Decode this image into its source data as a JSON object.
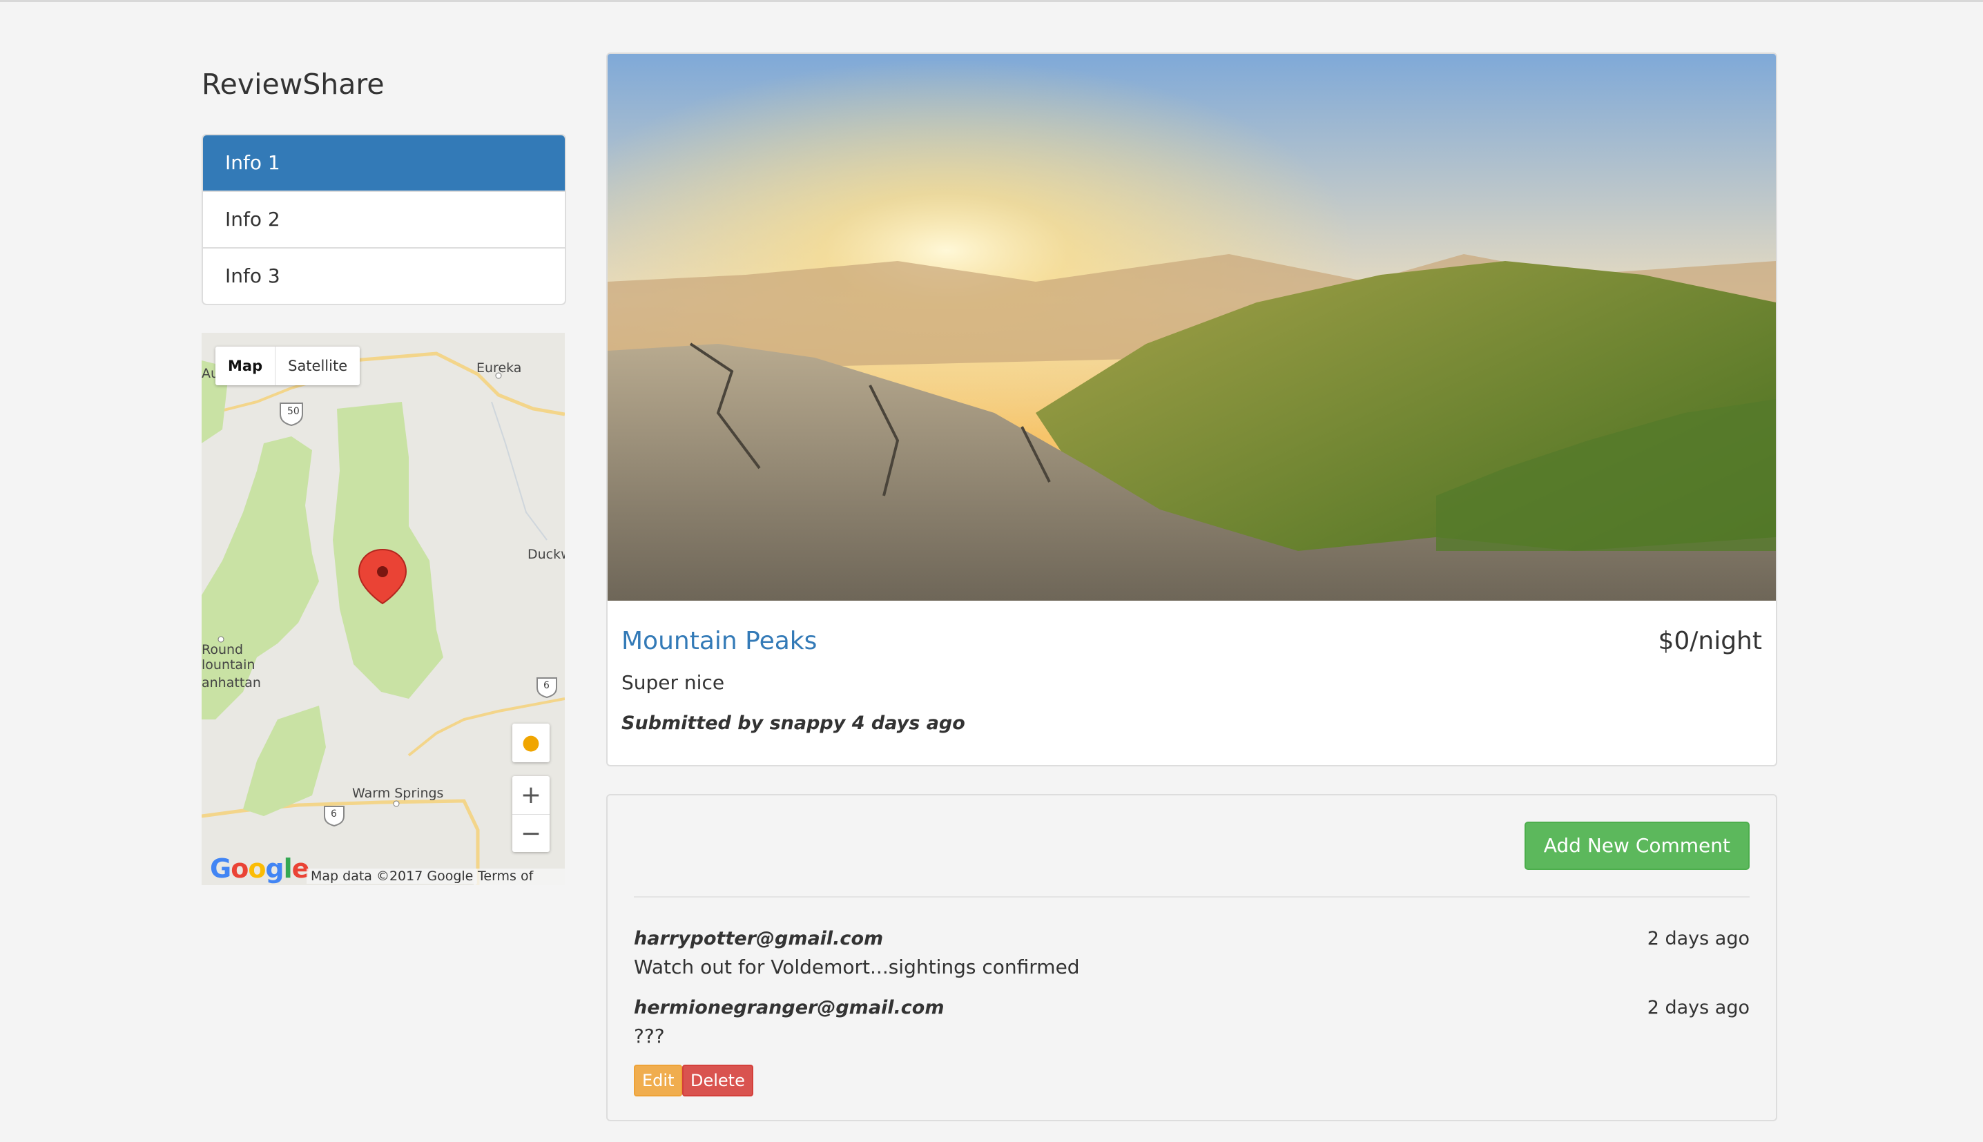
{
  "app": {
    "brand": "ReviewShare"
  },
  "sidebar": {
    "items": [
      {
        "label": "Info 1",
        "active": true
      },
      {
        "label": "Info 2",
        "active": false
      },
      {
        "label": "Info 3",
        "active": false
      }
    ]
  },
  "map": {
    "type_buttons": [
      "Map",
      "Satellite"
    ],
    "labels": {
      "eureka": "Eureka",
      "au": "Au",
      "duckw": "Duckw",
      "round": "Round",
      "mountain": "lountain",
      "manhattan": "anhattan",
      "warm_springs": "Warm Springs",
      "route_50": "50",
      "route_6a": "6",
      "route_6b": "6"
    },
    "zoom_in": "+",
    "zoom_out": "−",
    "logo": "Google",
    "data_attribution": "Map data ©2017 Google",
    "terms": "Terms of Use"
  },
  "listing": {
    "title": "Mountain Peaks",
    "price": "$0/night",
    "description": "Super nice",
    "submitted": "Submitted by snappy 4 days ago"
  },
  "comments": {
    "add_button": "Add New Comment",
    "items": [
      {
        "author": "harrypotter@gmail.com",
        "time": "2 days ago",
        "text": "Watch out for Voldemort...sightings confirmed"
      },
      {
        "author": "hermionegranger@gmail.com",
        "time": "2 days ago",
        "text": "???"
      }
    ],
    "edit_label": "Edit",
    "delete_label": "Delete"
  },
  "colors": {
    "primary": "#337ab7",
    "success": "#5cb85c",
    "warning": "#f0ad4e",
    "danger": "#d9534f"
  }
}
